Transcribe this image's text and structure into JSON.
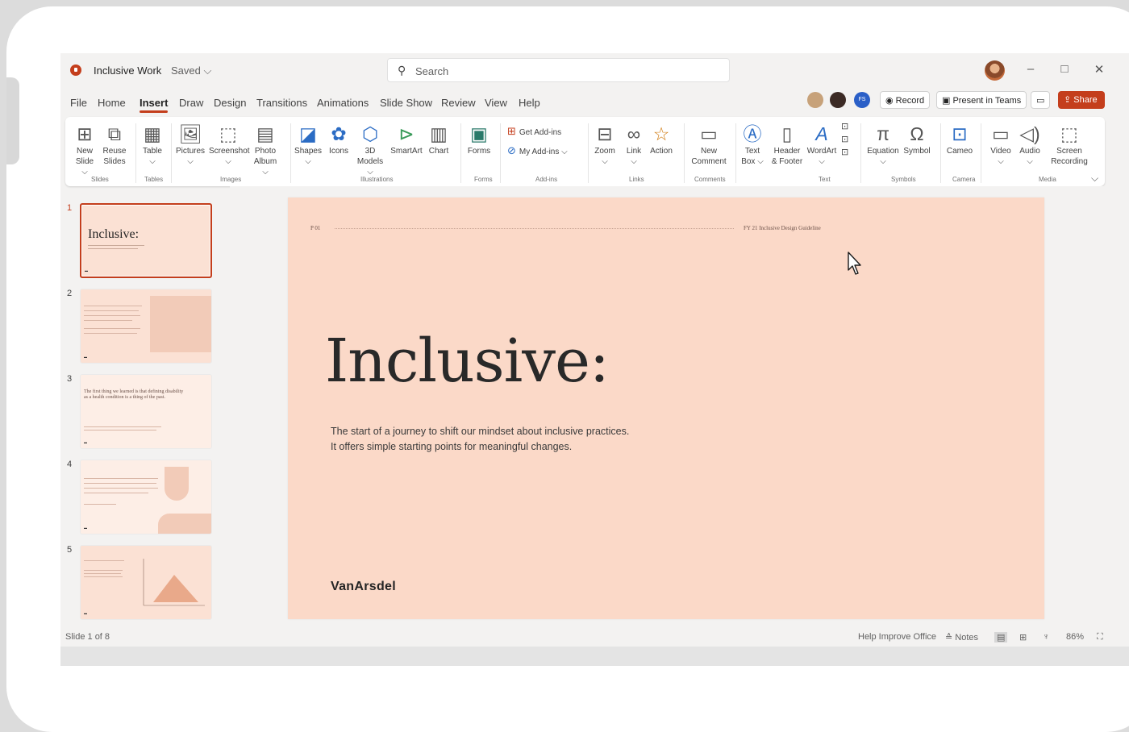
{
  "titlebar": {
    "doc_title": "Inclusive Work",
    "doc_status": "Saved ⌵",
    "search_placeholder": "Search",
    "minimize": "–",
    "maximize": "□",
    "close": "✕"
  },
  "menu": {
    "tabs": [
      "File",
      "Home",
      "Insert",
      "Draw",
      "Design",
      "Transitions",
      "Animations",
      "Slide Show",
      "Review",
      "View",
      "Help"
    ],
    "record_label": "Record",
    "present_label": "Present in Teams",
    "share_label": "Share",
    "user_initials": "FS"
  },
  "ribbon": {
    "new_slide": "New\nSlide ⌵",
    "reuse_slides": "Reuse\nSlides",
    "table": "Table\n⌵",
    "pictures": "Pictures\n⌵",
    "screenshot": "Screenshot\n⌵",
    "photo_album": "Photo\nAlbum ⌵",
    "shapes": "Shapes\n⌵",
    "icons": "Icons",
    "models_3d": "3D\nModels ⌵",
    "smartart": "SmartArt",
    "chart": "Chart",
    "forms": "Forms",
    "get_addins": "Get Add-ins",
    "my_addins": "My Add-ins ⌵",
    "zoom": "Zoom\n⌵",
    "link": "Link\n⌵",
    "action": "Action",
    "new_comment": "New\nComment",
    "text_box": "Text\nBox ⌵",
    "header_footer": "Header\n& Footer",
    "wordart": "WordArt\n⌵",
    "equation": "Equation\n⌵",
    "symbol": "Symbol",
    "cameo": "Cameo",
    "video": "Video\n⌵",
    "audio": "Audio\n⌵",
    "screen_recording": "Screen\nRecording",
    "groups": {
      "slides": "Slides",
      "tables": "Tables",
      "images": "Images",
      "illustrations": "Illustrations",
      "forms": "Forms",
      "addins": "Add-ins",
      "links": "Links",
      "comments": "Comments",
      "text": "Text",
      "symbols": "Symbols",
      "camera": "Camera",
      "media": "Media"
    }
  },
  "thumbnails": {
    "numbers": [
      "1",
      "2",
      "3",
      "4",
      "5"
    ],
    "slide1_title": "Inclusive:",
    "slide3_text": "The first thing we learned is that defining disability as a health condition is a thing of the past."
  },
  "slide": {
    "page": "P 01",
    "guide": "FY 21 Inclusive Design Guideline",
    "title": "Inclusive:",
    "subtitle_line1": "The start of a journey to shift our mindset about inclusive practices.",
    "subtitle_line2": "It offers simple starting points for meaningful changes.",
    "brand": "VanArsdel"
  },
  "status": {
    "slide_count": "Slide 1 of 8",
    "help_improve": "Help Improve Office",
    "notes": "≙ Notes",
    "zoom": "86%"
  },
  "colors": {
    "accent": "#c43e1c",
    "slide_bg": "#fbd9c8"
  }
}
